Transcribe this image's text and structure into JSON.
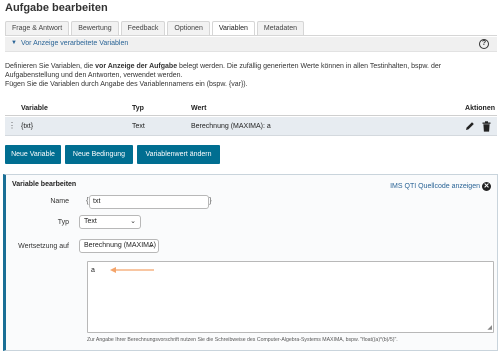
{
  "page": {
    "title": "Aufgabe bearbeiten"
  },
  "tabs": [
    {
      "label": "Frage & Antwort",
      "active": false
    },
    {
      "label": "Bewertung",
      "active": false
    },
    {
      "label": "Feedback",
      "active": false
    },
    {
      "label": "Optionen",
      "active": false
    },
    {
      "label": "Variablen",
      "active": true
    },
    {
      "label": "Metadaten",
      "active": false
    }
  ],
  "collapse": {
    "label": "Vor Anzeige verarbeitete Variablen",
    "icon": "chevron-down-icon",
    "help_icon": "question-circle-icon",
    "help_glyph": "?"
  },
  "intro": {
    "line1_a": "Definieren Sie Variablen, die ",
    "line1_b": "vor Anzeige der Aufgabe",
    "line1_c": " belegt werden. Die zufällig generierten Werte können in allen Testinhalten, bspw. der",
    "line2": "Aufgabenstellung und den Antworten, verwendet werden.",
    "line3": "Fügen Sie die Variablen durch Angabe des Variablennamens ein (bspw. {var})."
  },
  "table": {
    "headers": {
      "variable": "Variable",
      "typ": "Typ",
      "wert": "Wert",
      "aktionen": "Aktionen"
    },
    "rows": [
      {
        "variable": "{txt}",
        "typ": "Text",
        "wert": "Berechnung (MAXIMA): a"
      }
    ],
    "drag_glyph": "⋮",
    "icons": {
      "edit": "pencil-icon",
      "delete": "trash-icon"
    }
  },
  "buttons": {
    "new_variable": "Neue Variable",
    "new_condition": "Neue Bedingung",
    "change_value": "Variablenwert ändern"
  },
  "panel": {
    "title": "Variable bearbeiten",
    "qti_link": "IMS QTI Quellcode anzeigen",
    "qti_close_glyph": "✕",
    "name_label": "Name",
    "name_value": "txt",
    "brace_open": "{",
    "brace_close": "}",
    "typ_label": "Typ",
    "typ_value": "Text",
    "wert_label": "Wertsetzung auf",
    "wert_value": "Berechnung (MAXIMA)",
    "textarea_value": "a",
    "caret_glyph": "⌄",
    "resize_glyph": "◢",
    "hint": "Zur Angabe Ihrer Berechnungsvorschrift nutzen Sie die Schreibweise des Computer-Algebra-Systems MAXIMA, bspw. \"float((a)*(b)/5)\"."
  },
  "colors": {
    "button_bg": "#006e91",
    "link": "#2a6496",
    "panel_border": "#1a6f96",
    "row_highlight": "#e7ecf1",
    "arrow": "#f4a46a"
  }
}
